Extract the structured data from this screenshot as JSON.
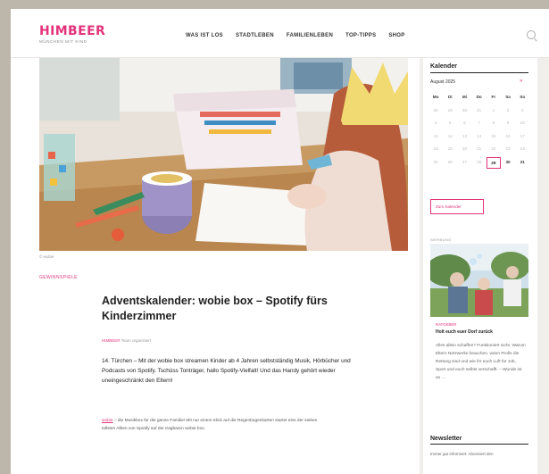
{
  "header": {
    "logo": "HIMBEER",
    "tagline": "MÜNCHEN MIT KIND",
    "nav": [
      "WAS IST LOS",
      "STADTLEBEN",
      "FAMILIENLEBEN",
      "TOP-TIPPS",
      "SHOP"
    ]
  },
  "article": {
    "credit": "© wobie",
    "category": "GEWINNSPIELE",
    "title": "Adventskalender: wobie box – Spotify fürs Kinderzimmer",
    "meta_highlight": "HIMBEER",
    "meta_rest": " Team organisiert",
    "lead": "14. Türchen – Mit der wobie box streamen Kinder ab 4 Jahren selbstständig Musik, Hörbücher und Podcasts von Spotify. Tschüss Tonträger, hallo Spotify-Vielfalt! Und das Handy gehört wieder uneingeschränkt den Eltern!",
    "body_link": "wobie",
    "body_rest": " – die Musikbox für die ganze Familie! Mit nur einem Klick auf die Regenbogenkarten startet eins der sieben tollsten Alben von Spotify auf der tragbaren wobie box."
  },
  "sidebar": {
    "calendar_heading": "Kalender",
    "month": "August 2025",
    "next_arrow": "»",
    "weekdays": [
      "Mo",
      "Di",
      "Mi",
      "Do",
      "Fr",
      "Sa",
      "So"
    ],
    "weeks": [
      [
        "28",
        "29",
        "30",
        "31",
        "1",
        "2",
        "3"
      ],
      [
        "4",
        "5",
        "6",
        "7",
        "8",
        "9",
        "10"
      ],
      [
        "11",
        "12",
        "13",
        "14",
        "15",
        "16",
        "17"
      ],
      [
        "18",
        "19",
        "20",
        "21",
        "22",
        "23",
        "24"
      ],
      [
        "25",
        "26",
        "27",
        "28",
        "29",
        "30",
        "31"
      ]
    ],
    "today": "29",
    "calendar_button": "Zum Kalender",
    "ad_label": "WERBUNG",
    "ad_category": "RATGEBER",
    "ad_title": "Holt euch euer Dorf zurück",
    "ad_text": "Alles allein schaffen? Funktioniert nicht. Warum Eltern Netzwerke brauchen, wann Profis die Rettung sind und wie ihr euch Luft für Job, Sport und euch selbst verschafft. – Wunde ist an …",
    "newsletter_heading": "Newsletter",
    "newsletter_text": "Immer gut informiert: Abonniert den"
  },
  "colors": {
    "accent": "#e3337a"
  }
}
